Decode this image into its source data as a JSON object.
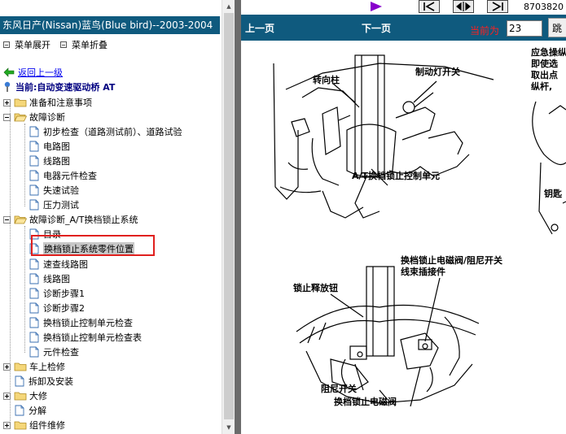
{
  "left_panel": {
    "title": "东风日产(Nissan)蓝鸟(Blue bird)--2003-2004",
    "expand_label": "菜单展开",
    "collapse_label": "菜单折叠",
    "back_label": "返回上一级",
    "current_label": "当前:自动变速驱动桥 AT",
    "tree": [
      {
        "label": "准备和注意事项",
        "type": "folder",
        "state": "collapsed"
      },
      {
        "label": "故障诊断",
        "type": "folder",
        "state": "expanded",
        "children": [
          "初步检查（道路测试前）、道路试验",
          "电路图",
          "线路图",
          "电器元件检查",
          "失速试验",
          "压力测试"
        ]
      },
      {
        "label": "故障诊断_A/T换档锁止系统",
        "type": "folder",
        "state": "expanded",
        "children": [
          "目录",
          "换档锁止系统零件位置",
          "速查线路图",
          "线路图",
          "诊断步骤1",
          "诊断步骤2",
          "换档锁止控制单元检查",
          "换档锁止控制单元检查表",
          "元件检查"
        ]
      },
      {
        "label": "车上检修",
        "type": "folder",
        "state": "collapsed"
      },
      {
        "label": "拆卸及安装",
        "type": "doc"
      },
      {
        "label": "大修",
        "type": "folder",
        "state": "collapsed"
      },
      {
        "label": "分解",
        "type": "doc"
      },
      {
        "label": "组件维修",
        "type": "folder",
        "state": "collapsed"
      }
    ],
    "selected_item": "换档锁止系统零件位置"
  },
  "nav": {
    "prev_label": "上一页",
    "next_label": "下一页",
    "current_page_label": "当前为",
    "current_page_value": "23",
    "jump_label": "跳",
    "top_number": "8703820"
  },
  "diagram": {
    "labels": {
      "steering_column": "转向柱",
      "brake_light_switch": "制动灯开关",
      "at_shift_lock_unit": "A/T换档锁止控制单元",
      "side_note_1": "应急操纵",
      "side_note_2": "即使选",
      "side_note_3": "取出点",
      "side_note_4": "纵杆,",
      "key_label": "钥匙",
      "solenoid_connector_1": "换档锁止电磁阀/阻尼开关",
      "solenoid_connector_2": "线束插接件",
      "lock_release_button": "锁止释放钮",
      "damper_switch": "阻尼开关",
      "shift_lock_solenoid": "换档锁止电磁阀"
    }
  },
  "colors": {
    "title_bar": "#0f5a7e",
    "highlight_box": "#e0201e",
    "page_label": "#ff2020",
    "link": "#0000ee"
  }
}
